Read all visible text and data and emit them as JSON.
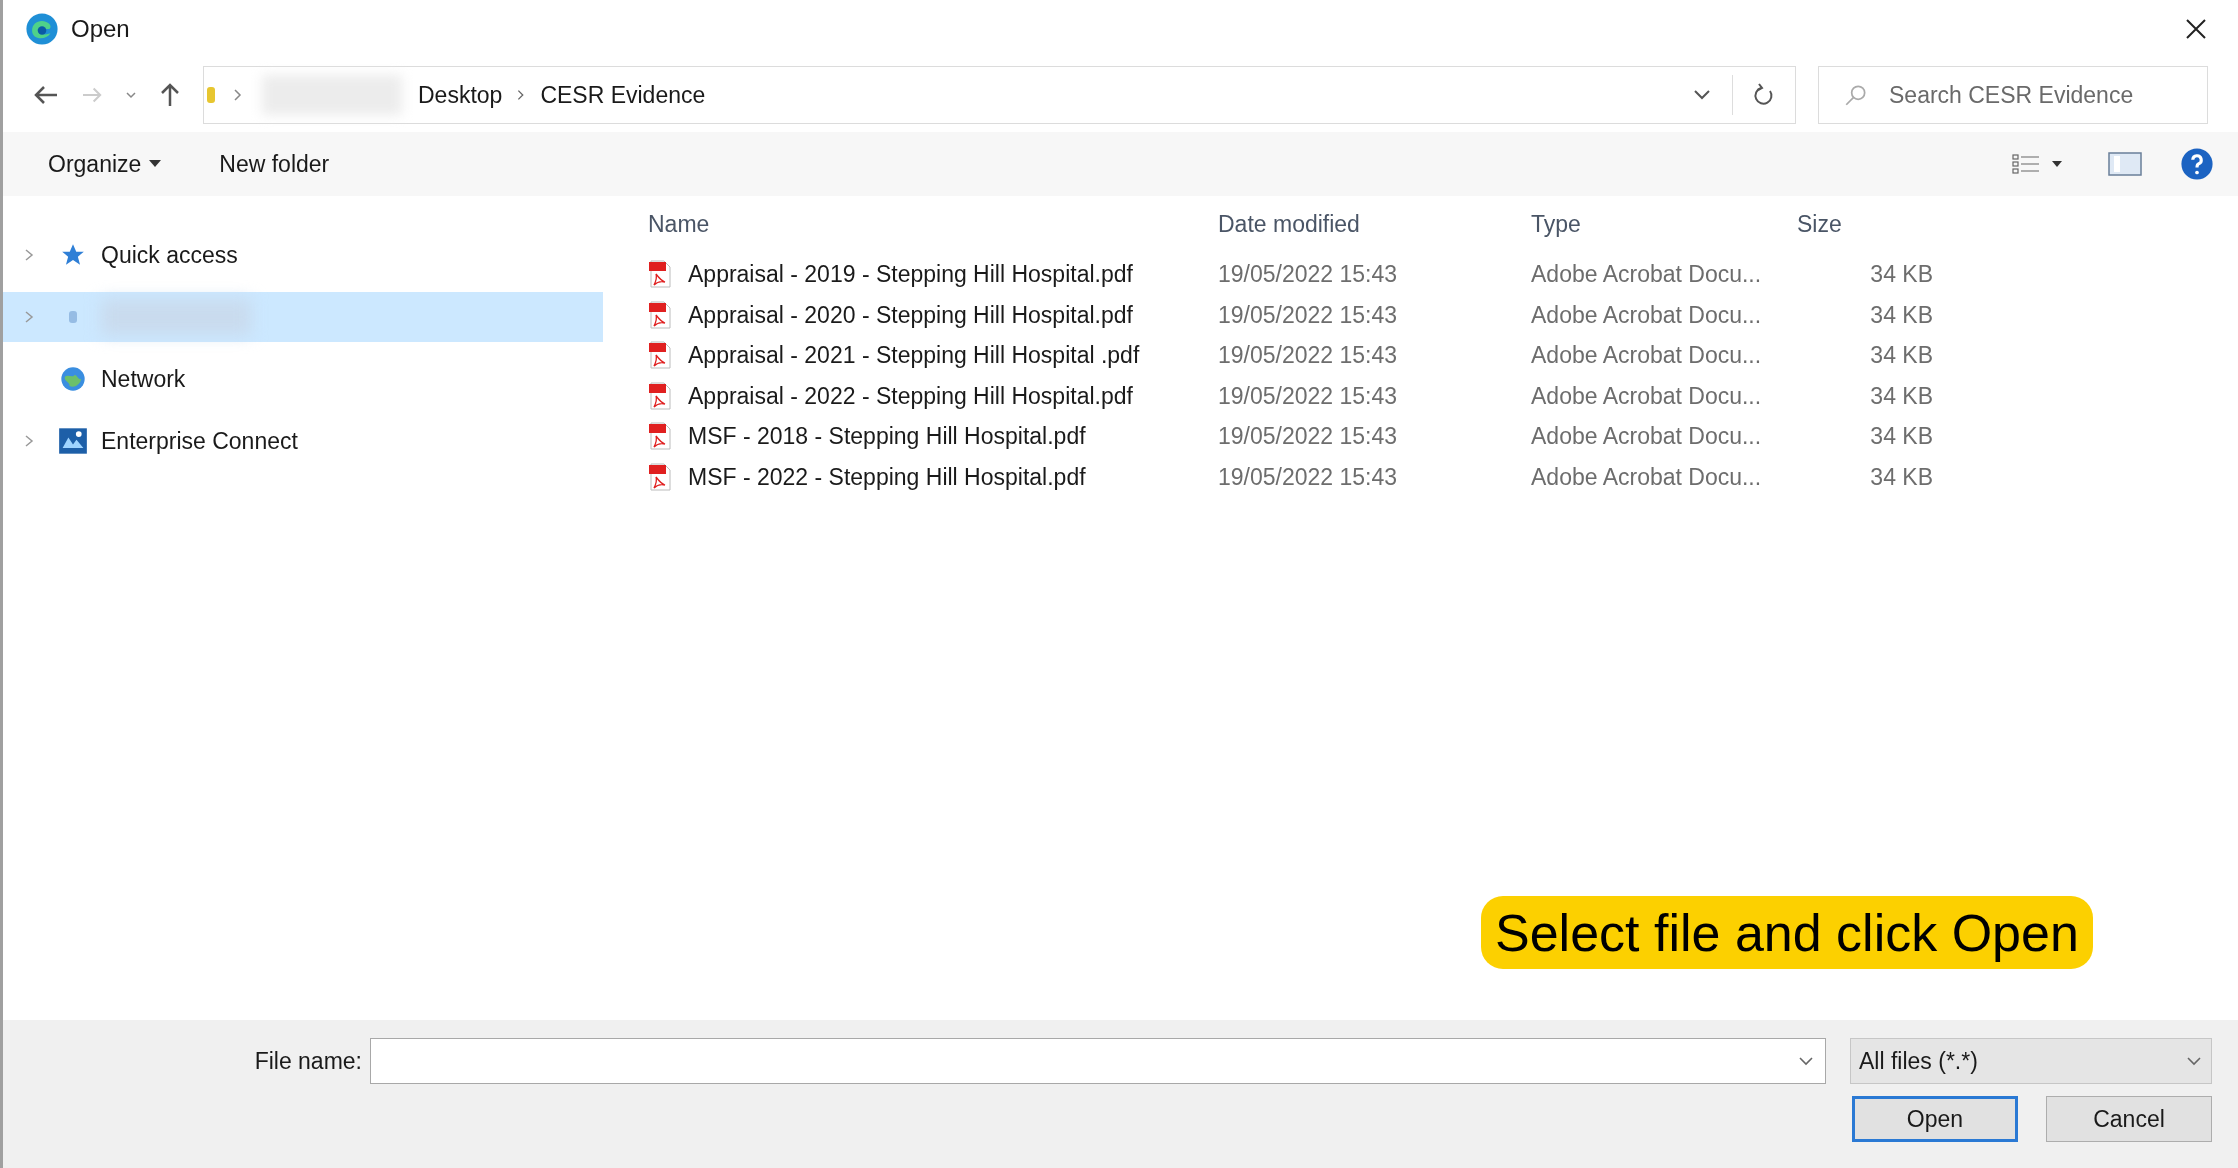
{
  "window": {
    "title": "Open"
  },
  "address": {
    "path": [
      "Desktop",
      "CESR Evidence"
    ]
  },
  "search": {
    "placeholder": "Search CESR Evidence"
  },
  "toolbar": {
    "organize": "Organize",
    "new_folder": "New folder"
  },
  "sidebar": {
    "items": [
      {
        "label": "Quick access",
        "kind": "star",
        "expandable": true,
        "selected": false
      },
      {
        "kind": "blurred",
        "expandable": true,
        "selected": true
      },
      {
        "label": "Network",
        "kind": "network",
        "expandable": false,
        "selected": false
      },
      {
        "label": "Enterprise Connect",
        "kind": "connect",
        "expandable": true,
        "selected": false
      }
    ]
  },
  "table": {
    "columns": [
      "Name",
      "Date modified",
      "Type",
      "Size"
    ],
    "rows": [
      [
        "Appraisal - 2019 - Stepping Hill Hospital.pdf",
        "19/05/2022 15:43",
        "Adobe Acrobat Docu...",
        "34 KB"
      ],
      [
        "Appraisal - 2020 - Stepping Hill Hospital.pdf",
        "19/05/2022 15:43",
        "Adobe Acrobat Docu...",
        "34 KB"
      ],
      [
        "Appraisal - 2021 - Stepping Hill Hospital .pdf",
        "19/05/2022 15:43",
        "Adobe Acrobat Docu...",
        "34 KB"
      ],
      [
        "Appraisal - 2022 - Stepping Hill Hospital.pdf",
        "19/05/2022 15:43",
        "Adobe Acrobat Docu...",
        "34 KB"
      ],
      [
        "MSF - 2018 - Stepping Hill Hospital.pdf",
        "19/05/2022 15:43",
        "Adobe Acrobat Docu...",
        "34 KB"
      ],
      [
        "MSF - 2022 - Stepping Hill Hospital.pdf",
        "19/05/2022 15:43",
        "Adobe Acrobat Docu...",
        "34 KB"
      ]
    ]
  },
  "callout": "Select file and click Open",
  "footer": {
    "file_name_label": "File name:",
    "filter": "All files (*.*)",
    "buttons": [
      "Open",
      "Cancel"
    ]
  }
}
